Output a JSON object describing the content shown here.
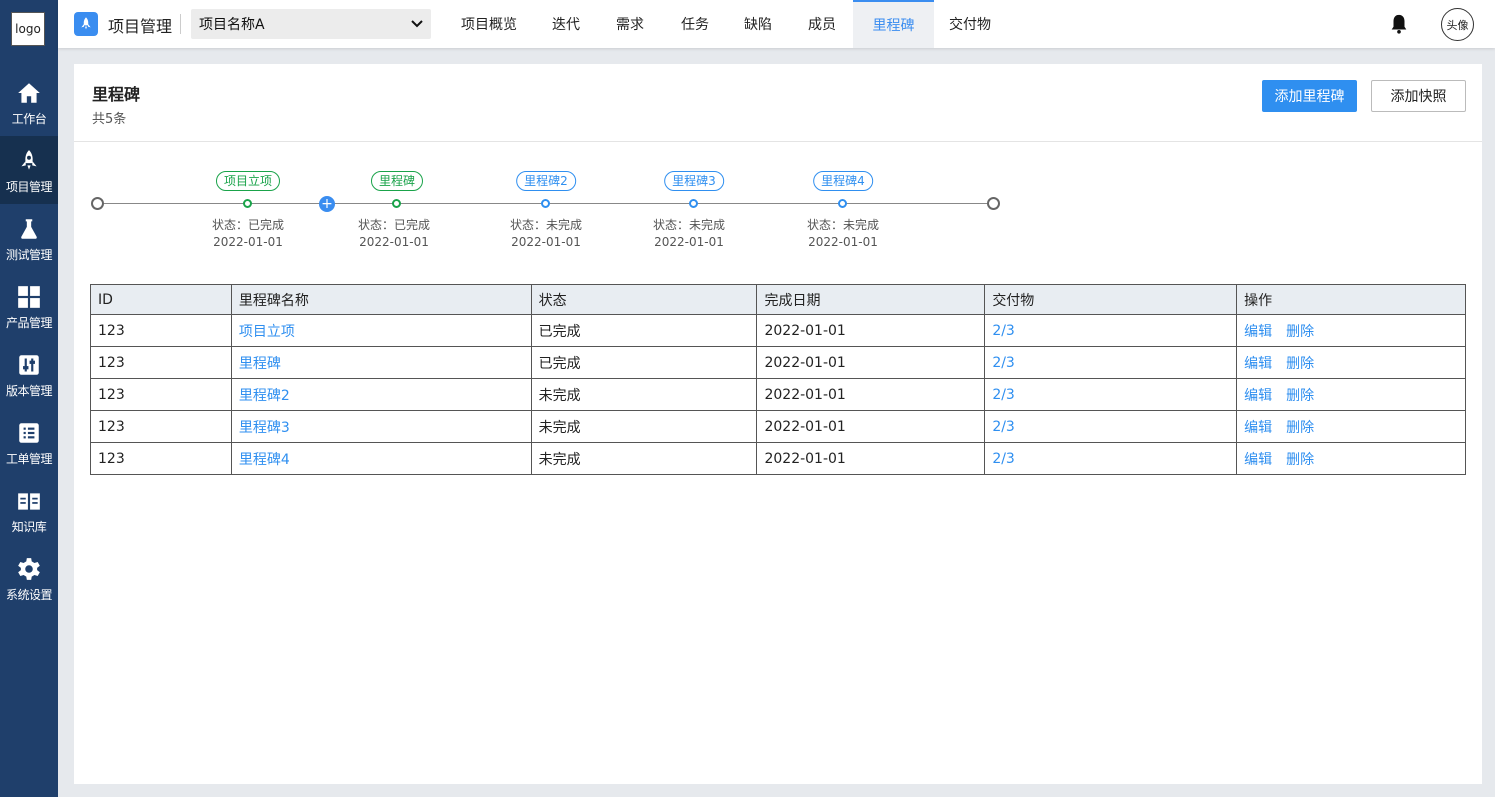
{
  "sidebar": {
    "logo": "logo",
    "items": [
      {
        "label": "工作台",
        "icon": "home-icon"
      },
      {
        "label": "项目管理",
        "icon": "rocket-icon"
      },
      {
        "label": "测试管理",
        "icon": "flask-icon"
      },
      {
        "label": "产品管理",
        "icon": "grid-icon"
      },
      {
        "label": "版本管理",
        "icon": "sliders-icon"
      },
      {
        "label": "工单管理",
        "icon": "list-icon"
      },
      {
        "label": "知识库",
        "icon": "book-icon"
      },
      {
        "label": "系统设置",
        "icon": "gear-icon"
      }
    ],
    "active_index": 1
  },
  "header": {
    "title": "项目管理",
    "project_select": "项目名称A",
    "tabs": [
      "项目概览",
      "迭代",
      "需求",
      "任务",
      "缺陷",
      "成员",
      "里程碑",
      "交付物"
    ],
    "active_tab": "里程碑",
    "avatar": "头像"
  },
  "page": {
    "title": "里程碑",
    "count": "共5条",
    "add_milestone": "添加里程碑",
    "add_snapshot": "添加快照"
  },
  "timeline": [
    {
      "name": "项目立项",
      "status": "状态：已完成",
      "date": "2022-01-01",
      "done": true
    },
    {
      "name": "里程碑",
      "status": "状态：已完成",
      "date": "2022-01-01",
      "done": true
    },
    {
      "name": "里程碑2",
      "status": "状态：未完成",
      "date": "2022-01-01",
      "done": false
    },
    {
      "name": "里程碑3",
      "status": "状态：未完成",
      "date": "2022-01-01",
      "done": false
    },
    {
      "name": "里程碑4",
      "status": "状态：未完成",
      "date": "2022-01-01",
      "done": false
    }
  ],
  "table": {
    "headers": [
      "ID",
      "里程碑名称",
      "状态",
      "完成日期",
      "交付物",
      "操作"
    ],
    "rows": [
      {
        "id": "123",
        "name": "项目立项",
        "status": "已完成",
        "date": "2022-01-01",
        "deliverable": "2/3"
      },
      {
        "id": "123",
        "name": "里程碑",
        "status": "已完成",
        "date": "2022-01-01",
        "deliverable": "2/3"
      },
      {
        "id": "123",
        "name": "里程碑2",
        "status": "未完成",
        "date": "2022-01-01",
        "deliverable": "2/3"
      },
      {
        "id": "123",
        "name": "里程碑3",
        "status": "未完成",
        "date": "2022-01-01",
        "deliverable": "2/3"
      },
      {
        "id": "123",
        "name": "里程碑4",
        "status": "未完成",
        "date": "2022-01-01",
        "deliverable": "2/3"
      }
    ],
    "edit_label": "编辑",
    "delete_label": "删除"
  },
  "colors": {
    "sidebar": "#1f3f6b",
    "accent": "#2f8ff0",
    "done": "#1aa34a"
  }
}
